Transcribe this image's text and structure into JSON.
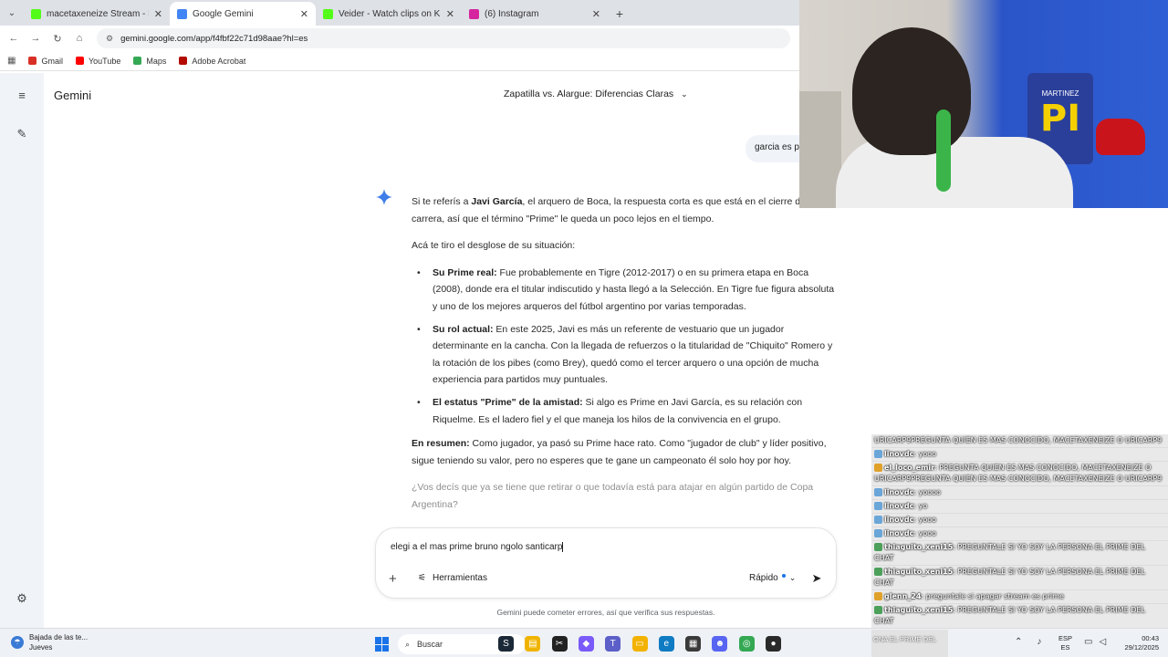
{
  "browser": {
    "tabs": [
      {
        "title": "macetaxeneize Stream - Kick D",
        "color": "#53fc18",
        "active": false
      },
      {
        "title": "Google Gemini",
        "color": "#4285f4",
        "active": true
      },
      {
        "title": "Veider - Watch clips on Kick",
        "color": "#53fc18",
        "active": false
      },
      {
        "title": "(6) Instagram",
        "color": "#d6249f",
        "active": false
      }
    ],
    "url": "gemini.google.com/app/f4fbf22c71d98aae?hl=es",
    "bookmarks": [
      {
        "label": "Gmail",
        "color": "#d93025"
      },
      {
        "label": "YouTube",
        "color": "#ff0000"
      },
      {
        "label": "Maps",
        "color": "#34a853"
      },
      {
        "label": "Adobe Acrobat",
        "color": "#b30b00"
      }
    ]
  },
  "gemini": {
    "brand": "Gemini",
    "conversation_title": "Zapatilla vs. Alargue: Diferencias Claras",
    "user_message": "garcia es p",
    "answer": {
      "intro_pre": "Si te referís a ",
      "intro_name": "Javi García",
      "intro_post": ", el arquero de Boca, la respuesta corta es que está en el cierre de su carrera, así que el término \"Prime\" le queda un poco lejos en el tiempo.",
      "lead": "Acá te tiro el desglose de su situación:",
      "bullets": [
        {
          "title": "Su Prime real:",
          "text": " Fue probablemente en Tigre (2012-2017) o en su primera etapa en Boca (2008), donde era el titular indiscutido y hasta llegó a la Selección. En Tigre fue figura absoluta y uno de los mejores arqueros del fútbol argentino por varias temporadas."
        },
        {
          "title": "Su rol actual:",
          "text": " En este 2025, Javi es más un referente de vestuario que un jugador determinante en la cancha. Con la llegada de refuerzos o la titularidad de \"Chiquito\" Romero y la rotación de los pibes (como Brey), quedó como el tercer arquero o una opción de mucha experiencia para partidos muy puntuales."
        },
        {
          "title": "El estatus \"Prime\" de la amistad:",
          "text": " Si algo es Prime en Javi García, es su relación con Riquelme. Es el ladero fiel y el que maneja los hilos de la convivencia en el grupo."
        }
      ],
      "summary_title": "En resumen:",
      "summary_text": " Como jugador, ya pasó su Prime hace rato. Como \"jugador de club\" y líder positivo, sigue teniendo su valor, pero no esperes que te gane un campeonato él solo hoy por hoy.",
      "question": "¿Vos decís que ya se tiene que retirar o que todavía está para atajar en algún partido de Copa Argentina?"
    },
    "composer": {
      "text": "elegi a el mas prime bruno ngolo santicarp",
      "tools_label": "Herramientas",
      "mode_label": "Rápido",
      "disclaimer": "Gemini puede cometer errores, así que verifica sus respuestas."
    }
  },
  "stream": {
    "jersey_text": "PI",
    "jersey_name": "MARTINEZ",
    "chat": [
      {
        "user": "",
        "msg": "URICARP9PREGUNTA QUIEN ES MAS CONOCIDO, MACETAXENEIZE O URICARP9",
        "badge": ""
      },
      {
        "user": "linovdc",
        "msg": ": yooo",
        "badge": "b"
      },
      {
        "user": "el_loco_emir",
        "msg": ": PREGUNTA QUIEN ES MAS CONOCIDO, MACETAXENEIZE O URICARP9PREGUNTA QUIEN ES MAS CONOCIDO, MACETAXENEIZE O URICARP9",
        "badge": "o"
      },
      {
        "user": "linovdc",
        "msg": ": yoooo",
        "badge": "b"
      },
      {
        "user": "linovdc",
        "msg": ": yo",
        "badge": "b"
      },
      {
        "user": "linovdc",
        "msg": ": yooo",
        "badge": "b"
      },
      {
        "user": "linovdc",
        "msg": ": yooo",
        "badge": "b"
      },
      {
        "user": "thiaguito_xeni15",
        "msg": ": PREGUNTALE SI YO SOY LA PERSONA EL PRIME DEL CHAT",
        "badge": "g"
      },
      {
        "user": "thiaguito_xeni15",
        "msg": ": PREGUNTALE SI YO SOY LA PERSONA EL PRIME DEL CHAT",
        "badge": "g"
      },
      {
        "user": "glenn_24",
        "msg": ": preguntale si apagar stream es prime",
        "badge": "o"
      },
      {
        "user": "thiaguito_xeni15",
        "msg": ": PREGUNTALE SI YO SOY LA PERSONA EL PRIME DEL CHAT",
        "badge": "g"
      }
    ],
    "tray_overflow": "ONA EL PRIME DEL"
  },
  "taskbar": {
    "weather_title": "Bajada de las te...",
    "weather_sub": "Jueves",
    "search_label": "Buscar",
    "lang_top": "ESP",
    "lang_bottom": "ES",
    "time": "00:43",
    "date": "29/12/2025",
    "apps": [
      {
        "name": "steam",
        "color": "#1b2838",
        "glyph": "S"
      },
      {
        "name": "files",
        "color": "#f0b400",
        "glyph": "▤"
      },
      {
        "name": "capcut",
        "color": "#222222",
        "glyph": "✂"
      },
      {
        "name": "copilot",
        "color": "#7a5af8",
        "glyph": "◆"
      },
      {
        "name": "teams",
        "color": "#5b5fc7",
        "glyph": "T"
      },
      {
        "name": "explorer",
        "color": "#f3b200",
        "glyph": "▭"
      },
      {
        "name": "edge",
        "color": "#0f7bc3",
        "glyph": "e"
      },
      {
        "name": "store",
        "color": "#3a3a3a",
        "glyph": "▦"
      },
      {
        "name": "discord",
        "color": "#5865f2",
        "glyph": "☻"
      },
      {
        "name": "chrome",
        "color": "#34a853",
        "glyph": "◎"
      },
      {
        "name": "obs",
        "color": "#2a2a2a",
        "glyph": "●"
      }
    ]
  }
}
